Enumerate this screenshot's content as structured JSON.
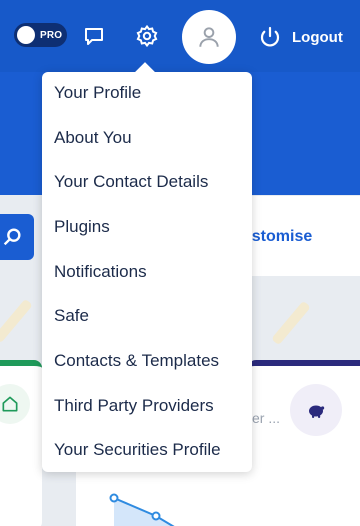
{
  "header": {
    "pro_badge": "PRO",
    "logout_label": "Logout"
  },
  "content": {
    "customise_label": "ustomise",
    "faded_label": "er ..."
  },
  "menu": {
    "items": [
      {
        "label": "Your Profile"
      },
      {
        "label": "About You"
      },
      {
        "label": "Your Contact Details"
      },
      {
        "label": "Plugins"
      },
      {
        "label": "Notifications"
      },
      {
        "label": "Safe"
      },
      {
        "label": "Contacts & Templates"
      },
      {
        "label": "Third Party Providers"
      },
      {
        "label": "Your Securities Profile"
      }
    ]
  },
  "colors": {
    "header_blue": "#1759c9",
    "accent_blue": "#1a5dd2",
    "green_border": "#1f9a5a",
    "navy_border": "#2b2a7d"
  }
}
